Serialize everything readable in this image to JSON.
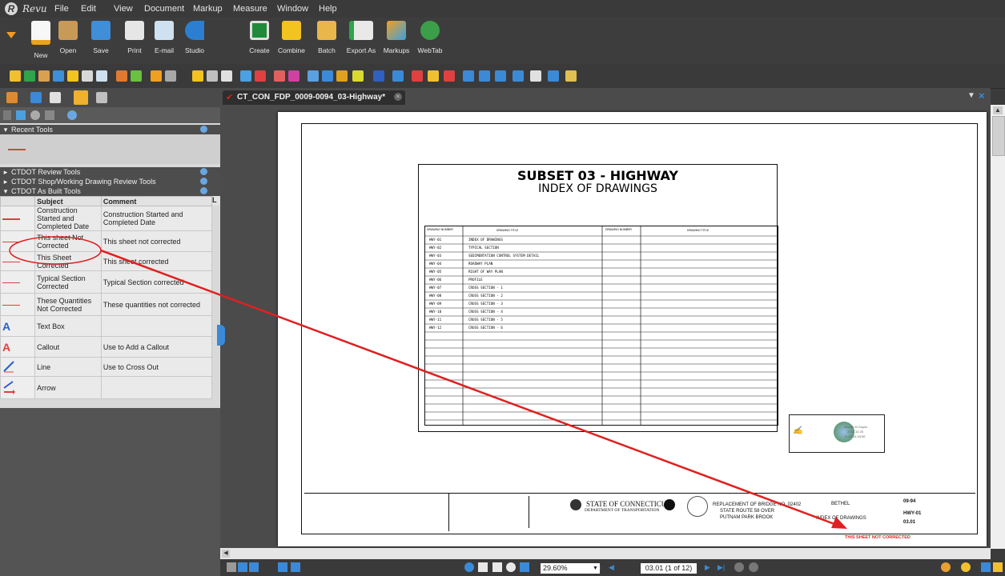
{
  "menubar": {
    "brand": "Revu",
    "items": [
      "File",
      "Edit",
      "View",
      "Document",
      "Markup",
      "Measure",
      "Window",
      "Help"
    ]
  },
  "toolbar": {
    "buttons": [
      "New",
      "Open",
      "Save",
      "Print",
      "E-mail",
      "Studio",
      "Create",
      "Combine",
      "Batch",
      "Export As",
      "Markups",
      "WebTab"
    ]
  },
  "left_panel": {
    "sections": {
      "recent": "Recent Tools",
      "review": "CTDOT Review Tools",
      "shop": "CTDOT Shop/Working Drawing Review Tools",
      "asbuilt": "CTDOT As Built Tools"
    },
    "table": {
      "headers": [
        "Subject",
        "Comment",
        "L"
      ],
      "rows": [
        {
          "subject": "Construction Started and Completed Date",
          "comment": "Construction Started and Completed Date"
        },
        {
          "subject": "This sheet Not Corrected",
          "comment": "This sheet not corrected"
        },
        {
          "subject": "This Sheet Corrected",
          "comment": "This sheet corrected"
        },
        {
          "subject": "Typical Section Corrected",
          "comment": "Typical Section corrected"
        },
        {
          "subject": "These Quantities Not Corrected",
          "comment": "These quantities not corrected"
        },
        {
          "subject": "Text Box",
          "comment": ""
        },
        {
          "subject": "Callout",
          "comment": "Use to Add a Callout"
        },
        {
          "subject": "Line",
          "comment": "Use to Cross Out"
        },
        {
          "subject": "Arrow",
          "comment": ""
        }
      ]
    }
  },
  "document": {
    "tab_title": "CT_CON_FDP_0009-0094_03-Highway*",
    "index_title": "SUBSET 03 - HIGHWAY",
    "index_subtitle": "INDEX OF DRAWINGS",
    "col_headers": [
      "DRAWING NUMBER",
      "DRAWING TITLE",
      "DRAWING NUMBER",
      "DRAWING TITLE"
    ],
    "drawings": [
      {
        "num": "HWY-01",
        "title": "INDEX OF DRAWINGS"
      },
      {
        "num": "HWY-02",
        "title": "TYPICAL SECTION"
      },
      {
        "num": "HWY-03",
        "title": "SEDIMENTATION CONTROL SYSTEM DETAIL"
      },
      {
        "num": "HWY-04",
        "title": "ROADWAY PLAN"
      },
      {
        "num": "HWY-05",
        "title": "RIGHT OF WAY PLAN"
      },
      {
        "num": "HWY-06",
        "title": "PROFILE"
      },
      {
        "num": "HWY-07",
        "title": "CROSS SECTION - 1"
      },
      {
        "num": "HWY-08",
        "title": "CROSS SECTION - 2"
      },
      {
        "num": "HWY-09",
        "title": "CROSS SECTION - 3"
      },
      {
        "num": "HWY-10",
        "title": "CROSS SECTION - 4"
      },
      {
        "num": "HWY-11",
        "title": "CROSS SECTION - 5"
      },
      {
        "num": "HWY-12",
        "title": "CROSS SECTION - 6"
      }
    ],
    "stamp": {
      "name": "Madan M Gupta",
      "date": "2012.10.25",
      "time": "11:53:04-04'00'"
    },
    "titleblock": {
      "state1": "STATE OF CONNECTICUT",
      "state2": "DEPARTMENT OF TRANSPORTATION",
      "project1": "REPLACEMENT OF BRIDGE NO. 02402",
      "project2": "STATE ROUTE 58 OVER",
      "project3": "PUTNAM PARK BROOK",
      "town": "BETHEL",
      "sheet_title": "INDEX OF DRAWINGS",
      "drawing_no": "HWY-01",
      "sheet_no": "03.01",
      "project_no": "09-94"
    },
    "markup_stamp": "THIS SHEET NOT CORRECTED"
  },
  "status": {
    "zoom": "29.60%",
    "page": "03.01 (1 of 12)"
  },
  "colors": {
    "markup_red": "#e02020",
    "accent_blue": "#2a7fd4"
  }
}
